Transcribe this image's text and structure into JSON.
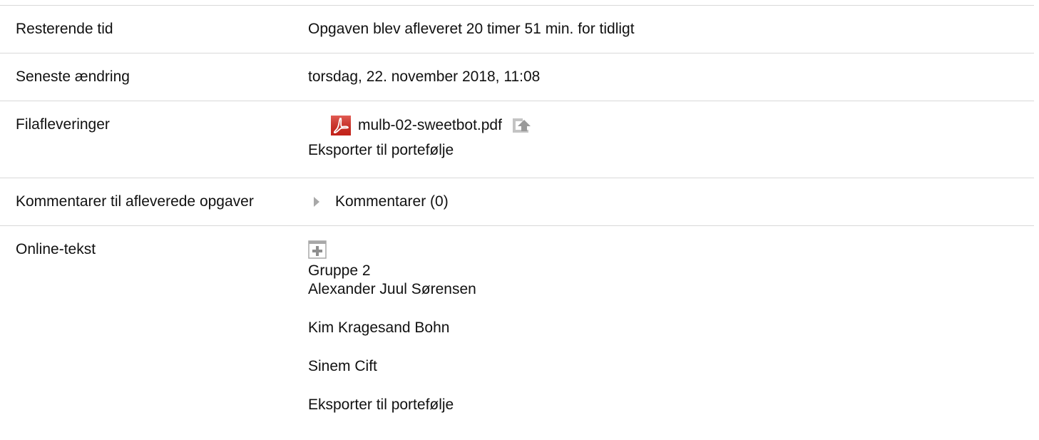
{
  "rows": [
    {
      "label": "Resterende tid",
      "value": "Opgaven blev afleveret 20 timer 51 min. for tidligt"
    },
    {
      "label": "Seneste ændring",
      "value": "torsdag, 22. november 2018, 11:08"
    },
    {
      "label": "Filafleveringer"
    },
    {
      "label": "Kommentarer til afleverede opgaver"
    },
    {
      "label": "Online-tekst"
    }
  ],
  "files": {
    "filename": "mulb-02-sweetbot.pdf",
    "file_icon": "pdf-icon",
    "upload_icon": "upload-icon",
    "export_label": "Eksporter til portefølje"
  },
  "comments": {
    "label": "Kommentarer (0)",
    "icon": "triangle-right-icon"
  },
  "online_text": {
    "expand_icon": "plus-square-icon",
    "group": "Gruppe 2",
    "members": [
      "Alexander Juul Sørensen",
      "Kim Kragesand Bohn",
      "Sinem Cift"
    ],
    "export_label": "Eksporter til portefølje"
  },
  "colors": {
    "pdf_red": "#d9261c",
    "icon_gray": "#a8a8a8",
    "divider": "#d9d9d9"
  }
}
